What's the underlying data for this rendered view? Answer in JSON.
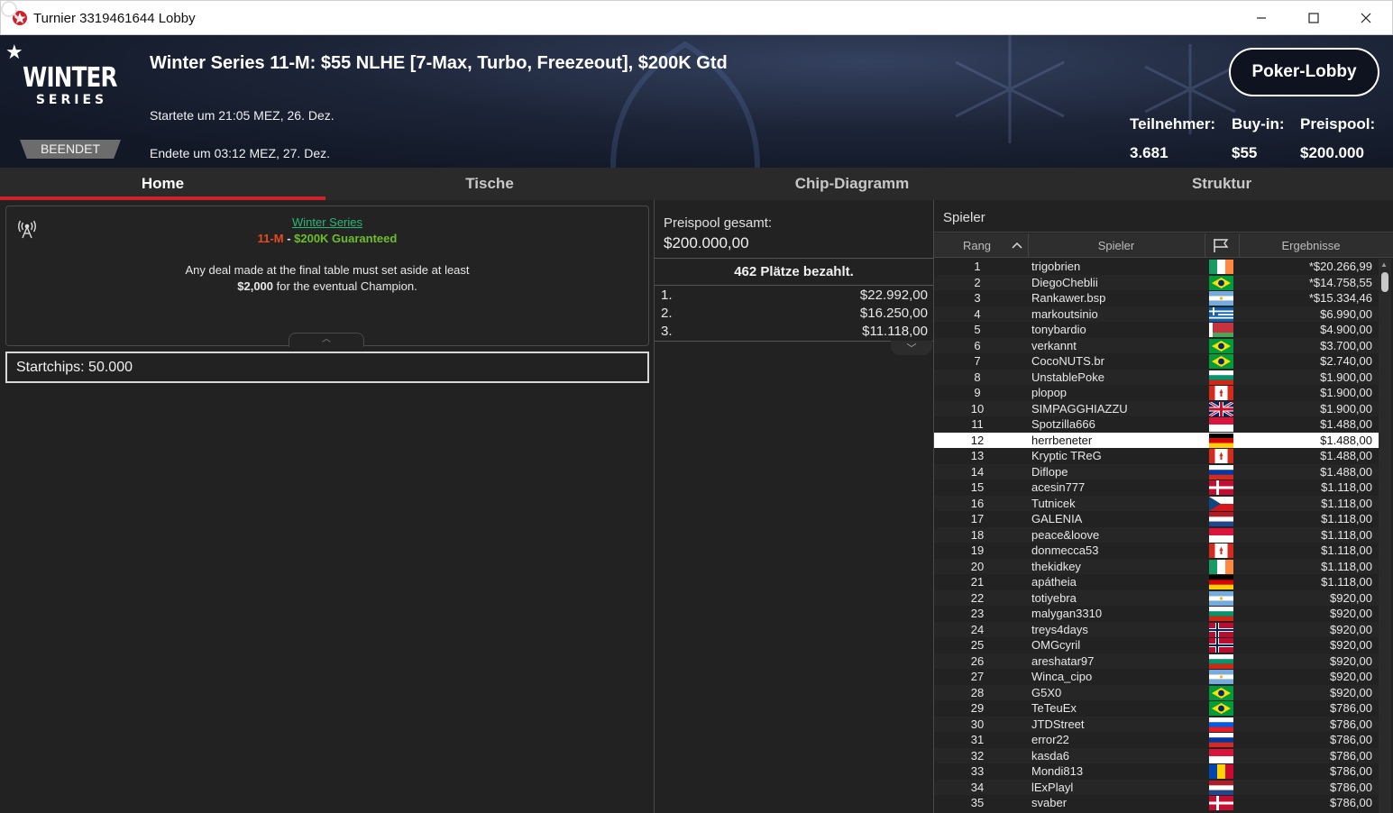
{
  "window": {
    "title": "Turnier 3319461644 Lobby"
  },
  "header": {
    "logo_line1": "WINTER",
    "logo_line2": "SERIES",
    "status_badge": "BEENDET",
    "tournament_title": "Winter Series 11-M: $55 NLHE [7-Max, Turbo, Freezeout], $200K Gtd",
    "started": "Startete um 21:05 MEZ, 26. Dez.",
    "ended": "Endete um 03:12 MEZ, 27. Dez.",
    "lobby_button": "Poker-Lobby",
    "stats": {
      "participants_label": "Teilnehmer:",
      "participants_value": "3.681",
      "buyin_label": "Buy-in:",
      "buyin_value": "$55",
      "prizepool_label": "Preispool:",
      "prizepool_value": "$200.000"
    }
  },
  "tabs": [
    "Home",
    "Tische",
    "Chip-Diagramm",
    "Struktur"
  ],
  "info": {
    "series_link": "Winter Series",
    "event_code": "11-M",
    "separator": " - ",
    "guarantee": "$200K Guaranteed",
    "deal_text_1": "Any deal made at the final table must set aside at least",
    "deal_amount": "$2,000",
    "deal_text_2": " for the eventual Champion.",
    "startchips_label": "Startchips:",
    "startchips_value": "50.000"
  },
  "prizes": {
    "total_label": "Preispool gesamt:",
    "total_value": "$200.000,00",
    "paid_places": "462 Plätze bezahlt.",
    "rows": [
      {
        "pos": "1.",
        "amount": "$22.992,00"
      },
      {
        "pos": "2.",
        "amount": "$16.250,00"
      },
      {
        "pos": "3.",
        "amount": "$11.118,00"
      }
    ]
  },
  "players": {
    "search_label": "Spieler",
    "columns": {
      "rank": "Rang",
      "player": "Spieler",
      "results": "Ergebnisse"
    },
    "rows": [
      {
        "rank": "1",
        "name": "trigobrien",
        "flag": "ireland",
        "result": "*$20.266,99"
      },
      {
        "rank": "2",
        "name": "DiegoCheblii",
        "flag": "brazil",
        "result": "*$14.758,55"
      },
      {
        "rank": "3",
        "name": "Rankawer.bsp",
        "flag": "argentina",
        "result": "*$15.334,46"
      },
      {
        "rank": "4",
        "name": "markoutsinio",
        "flag": "greece",
        "result": "$6.990,00"
      },
      {
        "rank": "5",
        "name": "tonybardio",
        "flag": "belarus",
        "result": "$4.900,00"
      },
      {
        "rank": "6",
        "name": "verkannt",
        "flag": "brazil",
        "result": "$3.700,00"
      },
      {
        "rank": "7",
        "name": "CocoNUTS.br",
        "flag": "brazil",
        "result": "$2.740,00"
      },
      {
        "rank": "8",
        "name": "UnstablePoke",
        "flag": "bulgaria",
        "result": "$1.900,00"
      },
      {
        "rank": "9",
        "name": "plopop",
        "flag": "canada",
        "result": "$1.900,00"
      },
      {
        "rank": "10",
        "name": "SIMPAGGHIAZZU",
        "flag": "uk",
        "result": "$1.900,00"
      },
      {
        "rank": "11",
        "name": "Spotzilla666",
        "flag": "red-white",
        "result": "$1.488,00"
      },
      {
        "rank": "12",
        "name": "herrbeneter",
        "flag": "germany",
        "result": "$1.488,00"
      },
      {
        "rank": "13",
        "name": "Kryptic TReG",
        "flag": "canada",
        "result": "$1.488,00"
      },
      {
        "rank": "14",
        "name": "Diflope",
        "flag": "russia",
        "result": "$1.488,00"
      },
      {
        "rank": "15",
        "name": "acesin777",
        "flag": "denmark",
        "result": "$1.118,00"
      },
      {
        "rank": "16",
        "name": "Tutnicek",
        "flag": "czech",
        "result": "$1.118,00"
      },
      {
        "rank": "17",
        "name": "GALENIA",
        "flag": "netherlands",
        "result": "$1.118,00"
      },
      {
        "rank": "18",
        "name": "peace&loove",
        "flag": "red-white",
        "result": "$1.118,00"
      },
      {
        "rank": "19",
        "name": "donmecca53",
        "flag": "canada",
        "result": "$1.118,00"
      },
      {
        "rank": "20",
        "name": "thekidkey",
        "flag": "ireland",
        "result": "$1.118,00"
      },
      {
        "rank": "21",
        "name": "apátheia",
        "flag": "germany",
        "result": "$1.118,00"
      },
      {
        "rank": "22",
        "name": "totiyebra",
        "flag": "argentina",
        "result": "$920,00"
      },
      {
        "rank": "23",
        "name": "malygan3310",
        "flag": "bulgaria",
        "result": "$920,00"
      },
      {
        "rank": "24",
        "name": "treys4days",
        "flag": "norway",
        "result": "$920,00"
      },
      {
        "rank": "25",
        "name": "OMGcyril",
        "flag": "norway",
        "result": "$920,00"
      },
      {
        "rank": "26",
        "name": "areshatar97",
        "flag": "bulgaria",
        "result": "$920,00"
      },
      {
        "rank": "27",
        "name": "Winca_cipo",
        "flag": "argentina",
        "result": "$920,00"
      },
      {
        "rank": "28",
        "name": "G5X0",
        "flag": "brazil",
        "result": "$920,00"
      },
      {
        "rank": "29",
        "name": "TeTeuEx",
        "flag": "brazil",
        "result": "$786,00"
      },
      {
        "rank": "30",
        "name": "JTDStreet",
        "flag": "slovenia",
        "result": "$786,00"
      },
      {
        "rank": "31",
        "name": "error22",
        "flag": "russia",
        "result": "$786,00"
      },
      {
        "rank": "32",
        "name": "kasda6",
        "flag": "red-white",
        "result": "$786,00"
      },
      {
        "rank": "33",
        "name": "Mondi813",
        "flag": "moldova",
        "result": "$786,00"
      },
      {
        "rank": "34",
        "name": "lExPlayl",
        "flag": "netherlands",
        "result": "$786,00"
      },
      {
        "rank": "35",
        "name": "svaber",
        "flag": "denmark",
        "result": "$786,00"
      }
    ]
  },
  "colors": {
    "accent_red": "#d0202a",
    "series_green": "#2bb673",
    "event_red": "#e84a20",
    "guarantee_green": "#6cbf2a"
  }
}
